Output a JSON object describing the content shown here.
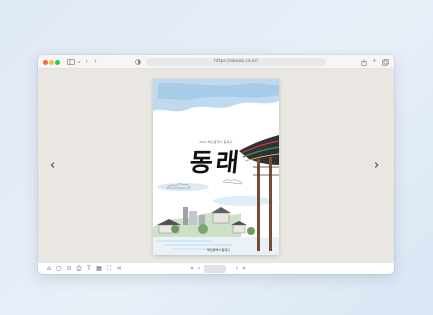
{
  "browser": {
    "url": "https://ebook.co.kr/",
    "traffic_lights": [
      "close",
      "minimize",
      "zoom"
    ],
    "toolbar_icons": [
      "sidebar-icon",
      "back-icon",
      "forward-icon",
      "privacy-icon",
      "share-icon",
      "new-tab-icon",
      "tabs-icon"
    ]
  },
  "viewer": {
    "prev_arrow": "‹",
    "next_arrow": "›",
    "cover": {
      "subtitle": "2024 부산광역시 동래구",
      "title": "동래",
      "publisher": "부산광역시 동래구"
    }
  },
  "bottom_toolbar": {
    "left_icons": [
      "home-icon",
      "bookmark-icon",
      "zoom-icon",
      "print-icon",
      "text-icon",
      "thumbnails-icon",
      "fullscreen-icon",
      "share-icon"
    ],
    "first_label": "«",
    "prev_label": "‹",
    "next_label": "›",
    "last_label": "»",
    "page_value": ""
  },
  "colors": {
    "background": "#e3ecf6",
    "window": "#eae7e2",
    "close": "#ff5f57",
    "minimize": "#febc2e",
    "zoom": "#28c840",
    "watercolor_blue": "#9ec6e4"
  }
}
